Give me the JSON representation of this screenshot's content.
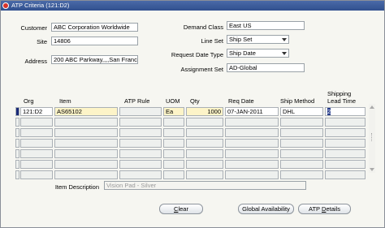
{
  "window": {
    "title": "ATP Criteria (121:D2)"
  },
  "header": {
    "customer_label": "Customer",
    "customer_value": "ABC Corporation Worldwide",
    "site_label": "Site",
    "site_value": "14806",
    "address_label": "Address",
    "address_value": "200 ABC Parkway,,,,San Franc",
    "demand_class_label": "Demand Class",
    "demand_class_value": "East US",
    "line_set_label": "Line Set",
    "line_set_value": "Ship Set",
    "request_date_type_label": "Request Date Type",
    "request_date_type_value": "Ship Date",
    "assignment_set_label": "Assignment Set",
    "assignment_set_value": "AD-Global"
  },
  "table": {
    "columns": [
      "Org",
      "Item",
      "ATP Rule",
      "UOM",
      "Qty",
      "Req Date",
      "Ship Method",
      "Shipping Lead Time"
    ],
    "rows": [
      {
        "org": "121:D2",
        "item": "AS65102",
        "atp_rule": "",
        "uom": "Ea",
        "qty": "1000",
        "req_date": "07-JAN-2011",
        "ship_method": "DHL",
        "lead_time": "2"
      }
    ],
    "empty_rows": 6
  },
  "footer": {
    "item_description_label": "Item Description",
    "item_description_value": "Vision Pad - Silver"
  },
  "buttons": {
    "clear_prefix": "",
    "clear_key": "C",
    "clear_rest": "lear",
    "global_availability": "Global Availability",
    "atp_prefix": "ATP ",
    "atp_key": "D",
    "atp_rest": "etails"
  },
  "colors": {
    "title_bar": "#3b5a9a",
    "current_row": "#1b2b78",
    "required_field": "#fdf4c8"
  }
}
